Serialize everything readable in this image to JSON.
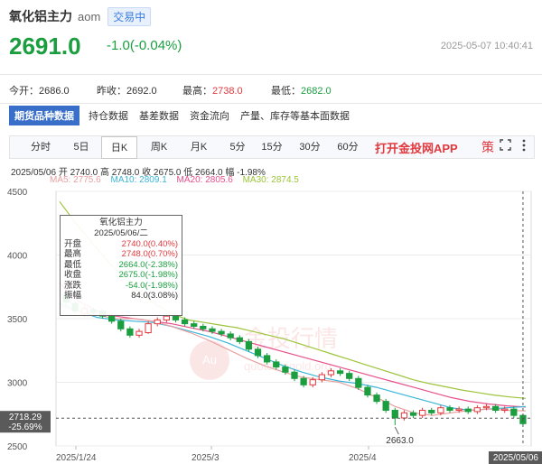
{
  "header": {
    "name": "氧化铝主力",
    "code": "aom",
    "badge": "交易中",
    "price": "2691.0",
    "change": "-1.0(-0.04%)",
    "time": "2025-05-07 10:40:41"
  },
  "stats": {
    "open_label": "今开：",
    "open_value": "2686.0",
    "prev_label": "昨收：",
    "prev_value": "2692.0",
    "high_label": "最高：",
    "high_value": "2738.0",
    "low_label": "最低：",
    "low_value": "2682.0"
  },
  "subtabs": [
    "期货品种数据",
    "持仓数据",
    "基差数据",
    "资金流向",
    "产量、库存等基本面数据"
  ],
  "periods": [
    "分时",
    "5日",
    "日K",
    "周K",
    "月K",
    "5分",
    "15分",
    "30分",
    "60分"
  ],
  "active_period": "日K",
  "app_link": "打开金投网APP",
  "strategy_label": "策",
  "icons": {
    "fullscreen": "fullscreen-icon",
    "more": "more-icon"
  },
  "ohlc_line": "2025/05/06  开 2740.0  高 2748.0  收 2675.0  低 2664.0  幅 -1.98%",
  "ma": {
    "ma5": "MA5: 2775.6",
    "ma10": "MA10: 2809.1",
    "ma20": "MA20: 2805.6",
    "ma30": "MA30: 2874.5"
  },
  "tooltip": {
    "title": "氧化铝主力",
    "date": "2025/05/06/二",
    "rows": [
      {
        "k": "开盘",
        "v": "2740.0(0.40%)",
        "c": "red"
      },
      {
        "k": "最高",
        "v": "2748.0(0.70%)",
        "c": "red"
      },
      {
        "k": "最低",
        "v": "2664.0(-2.38%)",
        "c": "green"
      },
      {
        "k": "收盘",
        "v": "2675.0(-1.98%)",
        "c": "green"
      },
      {
        "k": "涨跌",
        "v": "-54.0(-1.98%)",
        "c": "green"
      },
      {
        "k": "振幅",
        "v": "84.0(3.08%)",
        "c": "black"
      }
    ]
  },
  "cursor_label": {
    "price": "2718.29",
    "pct": "-25.69%"
  },
  "cursor_date": "2025/05/06",
  "watermark": {
    "cn": "金投行情",
    "en": "quote.cngold.org",
    "logo": "Au"
  },
  "low_annotation": "2663.0",
  "colors": {
    "up": "#e0393e",
    "down": "#1a9e3f",
    "ma5": "#e8a0a0",
    "ma10": "#3bb6d8",
    "ma20": "#e7508a",
    "ma30": "#9cc43a",
    "accent": "#3a6fc9"
  },
  "chart_data": {
    "type": "candlestick",
    "ylim": [
      2500,
      4500
    ],
    "y_ticks": [
      2500,
      3000,
      3500,
      4000,
      4500
    ],
    "x_ticks": [
      "2025/1/24",
      "2025/3",
      "2025/4"
    ],
    "candles": [
      {
        "o": 3690,
        "c": 3630,
        "h": 3710,
        "l": 3600
      },
      {
        "o": 3620,
        "c": 3560,
        "h": 3640,
        "l": 3540
      },
      {
        "o": 3540,
        "c": 3580,
        "h": 3600,
        "l": 3520
      },
      {
        "o": 3570,
        "c": 3550,
        "h": 3590,
        "l": 3530
      },
      {
        "o": 3560,
        "c": 3520,
        "h": 3580,
        "l": 3500
      },
      {
        "o": 3520,
        "c": 3480,
        "h": 3540,
        "l": 3460
      },
      {
        "o": 3480,
        "c": 3420,
        "h": 3500,
        "l": 3400
      },
      {
        "o": 3420,
        "c": 3370,
        "h": 3440,
        "l": 3350
      },
      {
        "o": 3370,
        "c": 3400,
        "h": 3420,
        "l": 3350
      },
      {
        "o": 3390,
        "c": 3460,
        "h": 3480,
        "l": 3380
      },
      {
        "o": 3460,
        "c": 3490,
        "h": 3510,
        "l": 3440
      },
      {
        "o": 3490,
        "c": 3520,
        "h": 3540,
        "l": 3470
      },
      {
        "o": 3520,
        "c": 3490,
        "h": 3540,
        "l": 3470
      },
      {
        "o": 3490,
        "c": 3460,
        "h": 3510,
        "l": 3440
      },
      {
        "o": 3460,
        "c": 3440,
        "h": 3480,
        "l": 3420
      },
      {
        "o": 3440,
        "c": 3420,
        "h": 3460,
        "l": 3400
      },
      {
        "o": 3420,
        "c": 3400,
        "h": 3440,
        "l": 3380
      },
      {
        "o": 3400,
        "c": 3380,
        "h": 3420,
        "l": 3360
      },
      {
        "o": 3380,
        "c": 3350,
        "h": 3400,
        "l": 3330
      },
      {
        "o": 3350,
        "c": 3320,
        "h": 3370,
        "l": 3300
      },
      {
        "o": 3320,
        "c": 3260,
        "h": 3340,
        "l": 3240
      },
      {
        "o": 3260,
        "c": 3210,
        "h": 3280,
        "l": 3190
      },
      {
        "o": 3210,
        "c": 3160,
        "h": 3230,
        "l": 3140
      },
      {
        "o": 3160,
        "c": 3120,
        "h": 3180,
        "l": 3100
      },
      {
        "o": 3120,
        "c": 3080,
        "h": 3140,
        "l": 3060
      },
      {
        "o": 3080,
        "c": 3030,
        "h": 3100,
        "l": 3010
      },
      {
        "o": 3030,
        "c": 2980,
        "h": 3050,
        "l": 2960
      },
      {
        "o": 2980,
        "c": 3020,
        "h": 3040,
        "l": 2960
      },
      {
        "o": 3020,
        "c": 3060,
        "h": 3080,
        "l": 3000
      },
      {
        "o": 3060,
        "c": 3090,
        "h": 3110,
        "l": 3040
      },
      {
        "o": 3090,
        "c": 3070,
        "h": 3110,
        "l": 3050
      },
      {
        "o": 3070,
        "c": 3030,
        "h": 3090,
        "l": 3010
      },
      {
        "o": 3030,
        "c": 2960,
        "h": 3050,
        "l": 2940
      },
      {
        "o": 2960,
        "c": 2900,
        "h": 2980,
        "l": 2880
      },
      {
        "o": 2900,
        "c": 2850,
        "h": 2920,
        "l": 2830
      },
      {
        "o": 2850,
        "c": 2780,
        "h": 2870,
        "l": 2760
      },
      {
        "o": 2780,
        "c": 2720,
        "h": 2800,
        "l": 2663
      },
      {
        "o": 2720,
        "c": 2760,
        "h": 2780,
        "l": 2700
      },
      {
        "o": 2760,
        "c": 2740,
        "h": 2780,
        "l": 2720
      },
      {
        "o": 2740,
        "c": 2780,
        "h": 2800,
        "l": 2720
      },
      {
        "o": 2780,
        "c": 2760,
        "h": 2800,
        "l": 2740
      },
      {
        "o": 2760,
        "c": 2800,
        "h": 2820,
        "l": 2740
      },
      {
        "o": 2800,
        "c": 2780,
        "h": 2820,
        "l": 2760
      },
      {
        "o": 2780,
        "c": 2790,
        "h": 2810,
        "l": 2760
      },
      {
        "o": 2790,
        "c": 2770,
        "h": 2810,
        "l": 2750
      },
      {
        "o": 2770,
        "c": 2800,
        "h": 2820,
        "l": 2750
      },
      {
        "o": 2800,
        "c": 2810,
        "h": 2830,
        "l": 2780
      },
      {
        "o": 2810,
        "c": 2780,
        "h": 2830,
        "l": 2760
      },
      {
        "o": 2780,
        "c": 2790,
        "h": 2810,
        "l": 2760
      },
      {
        "o": 2790,
        "c": 2740,
        "h": 2810,
        "l": 2720
      },
      {
        "o": 2740,
        "c": 2675,
        "h": 2748,
        "l": 2664
      }
    ],
    "ma30": [
      4420,
      4250,
      4100,
      3950,
      3820,
      3700,
      3610,
      3540,
      3490,
      3470,
      3450,
      3430,
      3400,
      3370,
      3340,
      3300,
      3260,
      3220,
      3180,
      3140,
      3100,
      3060,
      3020,
      2990,
      2965,
      2940,
      2920,
      2900,
      2885,
      2874
    ],
    "ma20": [
      3780,
      3640,
      3560,
      3520,
      3500,
      3480,
      3460,
      3430,
      3400,
      3360,
      3320,
      3280,
      3240,
      3200,
      3160,
      3120,
      3080,
      3040,
      3000,
      2960,
      2920,
      2880,
      2850,
      2830,
      2815,
      2806
    ],
    "ma10": [
      3620,
      3560,
      3510,
      3490,
      3480,
      3470,
      3440,
      3400,
      3360,
      3310,
      3250,
      3190,
      3130,
      3080,
      3040,
      3010,
      2990,
      2960,
      2920,
      2880,
      2840,
      2800,
      2780,
      2790,
      2800,
      2809
    ],
    "ma5": [
      3600,
      3560,
      3530,
      3500,
      3500,
      3480,
      3440,
      3390,
      3330,
      3260,
      3190,
      3130,
      3080,
      3040,
      3020,
      3000,
      2950,
      2880,
      2810,
      2760,
      2740,
      2760,
      2780,
      2790,
      2780,
      2775
    ]
  }
}
